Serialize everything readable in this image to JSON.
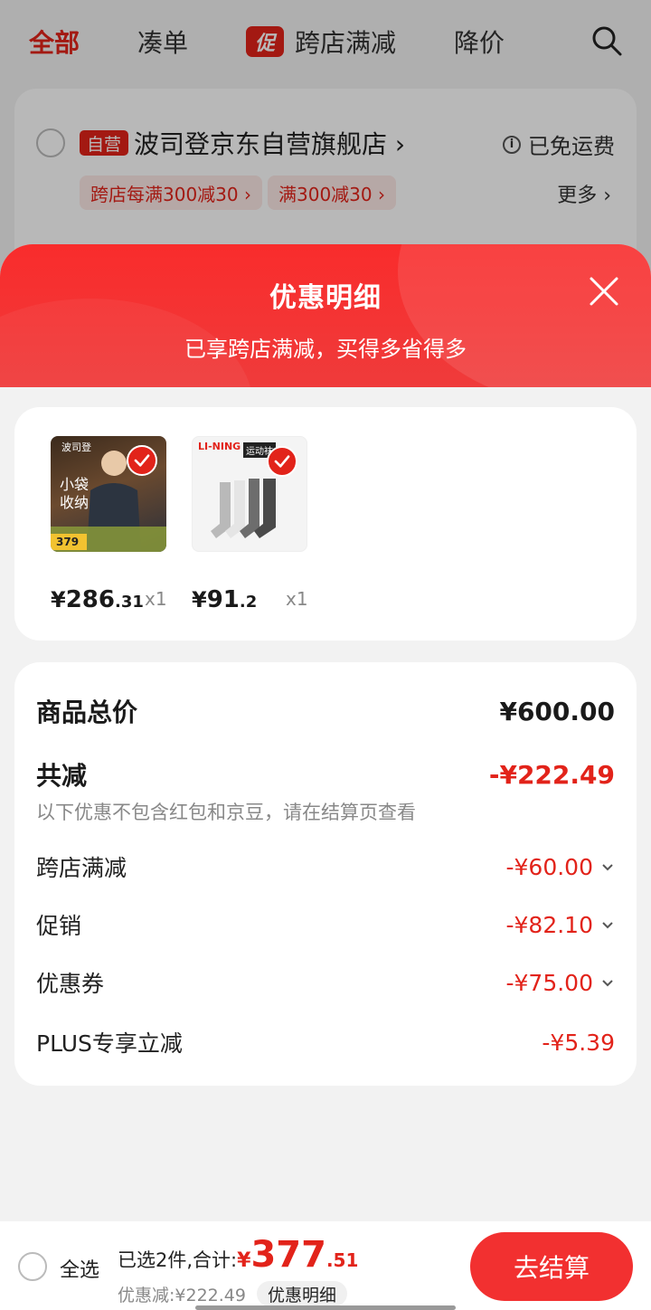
{
  "top_tabs": {
    "all": "全部",
    "combine": "凑单",
    "promo_badge": "促",
    "cross_store": "跨店满减",
    "price_drop": "降价"
  },
  "store": {
    "self_badge": "自营",
    "name": "波司登京东自营旗舰店 ›",
    "free_shipping": "已免运费",
    "info_icon_glyph": "i",
    "promo_chips": [
      "跨店每满300减30 ›",
      "满300减30 ›"
    ],
    "more": "更多 ›"
  },
  "sheet": {
    "title": "优惠明细",
    "subtitle": "已享跨店满减，买得多省得多"
  },
  "products": [
    {
      "currency": "¥",
      "price_int": "286",
      "price_dec": ".31",
      "qty": "x1",
      "thumb_texts": [
        "波司登",
        "小袋",
        "收纳",
        "379"
      ]
    },
    {
      "currency": "¥",
      "price_int": "91",
      "price_dec": ".2",
      "qty": "x1",
      "thumb_texts": [
        "LI-NING",
        "运动袜"
      ]
    }
  ],
  "summary": {
    "total_label": "商品总价",
    "total_value": "¥600.00",
    "discount_label": "共减",
    "discount_value": "-¥222.49",
    "note": "以下优惠不包含红包和京豆，请在结算页查看",
    "items": [
      {
        "label": "跨店满减",
        "value": "-¥60.00"
      },
      {
        "label": "促销",
        "value": "-¥82.10"
      },
      {
        "label": "优惠券",
        "value": "-¥75.00"
      },
      {
        "label": "PLUS专享立减",
        "value": "-¥5.39"
      }
    ]
  },
  "bottom": {
    "select_all": "全选",
    "total_label": "已选2件,合计:",
    "total_currency": "¥",
    "total_int": "377",
    "total_dec": ".51",
    "saved": "优惠减:¥222.49",
    "detail_button": "优惠明细",
    "checkout": "去结算"
  },
  "colors": {
    "accent": "#e2231a",
    "header": "#f92c2c"
  }
}
